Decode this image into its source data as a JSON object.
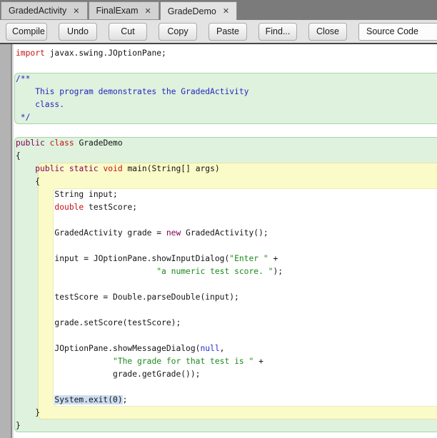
{
  "colors": {
    "keyword_red": "#c41414",
    "keyword_magenta": "#7f0055",
    "string_green": "#1b8a1b",
    "comment_blue": "#2626bf",
    "literal_blue": "#2a2ad2",
    "plain_text": "#141414",
    "scope_class_green": "#def2de",
    "scope_class_border": "#a9d3a9",
    "scope_method_yellow": "#fbfbc9",
    "scope_method_border": "#e3e3a2",
    "selection_blue": "#cddef0",
    "gutter_gray": "#b3b3b3",
    "tabbar_gray": "#7b7b7b",
    "toolbar_gray": "#e3e3e3"
  },
  "tabs": [
    {
      "label": "GradedActivity",
      "active": false
    },
    {
      "label": "FinalExam",
      "active": false
    },
    {
      "label": "GradeDemo",
      "active": true
    }
  ],
  "tab_close_glyph": "✕",
  "toolbar": {
    "buttons": [
      "Compile",
      "Undo",
      "Cut",
      "Copy",
      "Paste",
      "Find...",
      "Close"
    ],
    "view_selector": {
      "value": "Source Code"
    }
  },
  "editor": {
    "lines": [
      [
        [
          "import",
          "kred"
        ],
        [
          " javax.swing.JOptionPane;",
          "plain"
        ]
      ],
      [],
      [
        [
          "/**",
          "com"
        ]
      ],
      [
        [
          "    This program demonstrates the GradedActivity",
          "com"
        ]
      ],
      [
        [
          "    class.",
          "com"
        ]
      ],
      [
        [
          " */",
          "com"
        ]
      ],
      [],
      [
        [
          "public",
          "kmag"
        ],
        [
          " ",
          "plain"
        ],
        [
          "class",
          "kred"
        ],
        [
          " GradeDemo",
          "plain"
        ]
      ],
      [
        [
          "{",
          "plain"
        ]
      ],
      [
        [
          "    ",
          "plain"
        ],
        [
          "public",
          "kmag"
        ],
        [
          " ",
          "plain"
        ],
        [
          "static",
          "kmag"
        ],
        [
          " ",
          "plain"
        ],
        [
          "void",
          "kred"
        ],
        [
          " main(String[] args)",
          "plain"
        ]
      ],
      [
        [
          "    {",
          "plain"
        ]
      ],
      [
        [
          "        String input;",
          "plain"
        ]
      ],
      [
        [
          "        ",
          "plain"
        ],
        [
          "double",
          "kred"
        ],
        [
          " testScore;",
          "plain"
        ]
      ],
      [],
      [
        [
          "        GradedActivity grade = ",
          "plain"
        ],
        [
          "new",
          "kmag"
        ],
        [
          " GradedActivity();",
          "plain"
        ]
      ],
      [],
      [
        [
          "        input = JOptionPane.showInputDialog(",
          "plain"
        ],
        [
          "\"Enter \"",
          "str"
        ],
        [
          " +",
          "plain"
        ]
      ],
      [
        [
          "                             ",
          "plain"
        ],
        [
          "\"a numeric test score. \"",
          "str"
        ],
        [
          ");",
          "plain"
        ]
      ],
      [],
      [
        [
          "        testScore = Double.parseDouble(input);",
          "plain"
        ]
      ],
      [],
      [
        [
          "        grade.setScore(testScore);",
          "plain"
        ]
      ],
      [],
      [
        [
          "        JOptionPane.showMessageDialog(",
          "plain"
        ],
        [
          "null",
          "blue"
        ],
        [
          ",",
          "plain"
        ]
      ],
      [
        [
          "                    ",
          "plain"
        ],
        [
          "\"The grade for that test is \"",
          "str"
        ],
        [
          " +",
          "plain"
        ]
      ],
      [
        [
          "                    grade.getGrade());",
          "plain"
        ]
      ],
      [],
      [
        [
          "        ",
          "plain"
        ],
        [
          "System.exit(0)",
          "sel"
        ],
        [
          ";",
          "plain"
        ]
      ],
      [
        [
          "    }",
          "plain"
        ]
      ],
      [
        [
          "}",
          "plain"
        ]
      ]
    ]
  }
}
